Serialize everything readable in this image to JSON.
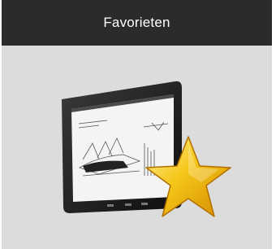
{
  "header": {
    "title": "Favorieten"
  },
  "illustration": {
    "description_icon": "tablet-with-favorite-star-icon",
    "star_color": "#f5c518"
  },
  "colors": {
    "header_bg": "#2b2b2b",
    "content_bg": "#dcdcdc"
  }
}
